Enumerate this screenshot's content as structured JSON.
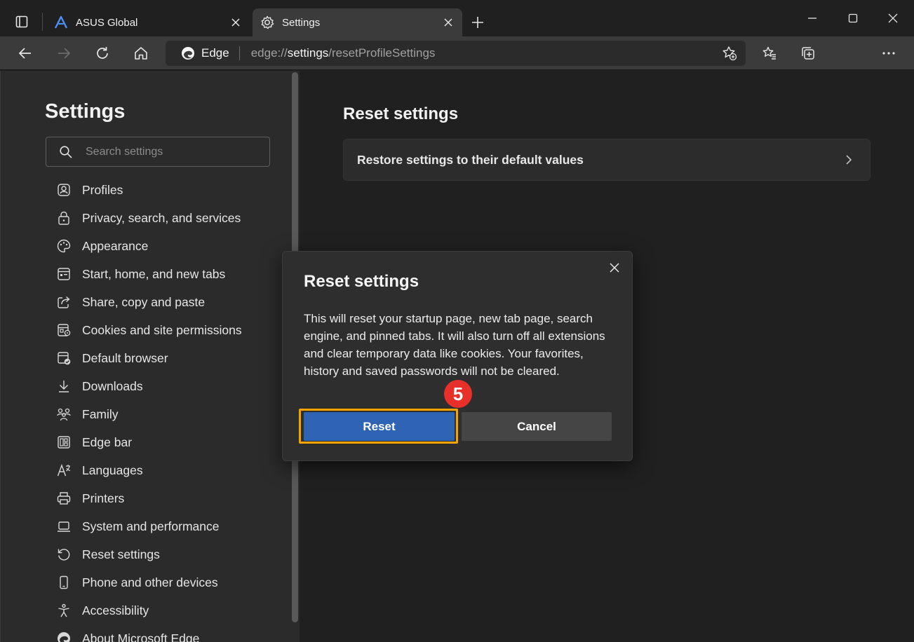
{
  "tabs": [
    {
      "title": "ASUS Global",
      "icon": "asus-logo-icon",
      "active": false
    },
    {
      "title": "Settings",
      "icon": "gear-icon",
      "active": true
    }
  ],
  "address_bar": {
    "site_name": "Edge",
    "url_scheme": "edge://",
    "url_host": "settings",
    "url_path": "/resetProfileSettings"
  },
  "sidebar": {
    "title": "Settings",
    "search_placeholder": "Search settings",
    "items": [
      {
        "label": "Profiles",
        "icon": "profile-icon"
      },
      {
        "label": "Privacy, search, and services",
        "icon": "lock-icon"
      },
      {
        "label": "Appearance",
        "icon": "palette-icon"
      },
      {
        "label": "Start, home, and new tabs",
        "icon": "start-page-icon"
      },
      {
        "label": "Share, copy and paste",
        "icon": "share-icon"
      },
      {
        "label": "Cookies and site permissions",
        "icon": "cookies-icon"
      },
      {
        "label": "Default browser",
        "icon": "default-browser-icon"
      },
      {
        "label": "Downloads",
        "icon": "download-icon"
      },
      {
        "label": "Family",
        "icon": "family-icon"
      },
      {
        "label": "Edge bar",
        "icon": "edge-bar-icon"
      },
      {
        "label": "Languages",
        "icon": "languages-icon"
      },
      {
        "label": "Printers",
        "icon": "printer-icon"
      },
      {
        "label": "System and performance",
        "icon": "laptop-icon"
      },
      {
        "label": "Reset settings",
        "icon": "reset-icon"
      },
      {
        "label": "Phone and other devices",
        "icon": "phone-icon"
      },
      {
        "label": "Accessibility",
        "icon": "accessibility-icon"
      },
      {
        "label": "About Microsoft Edge",
        "icon": "edge-logo-icon"
      }
    ]
  },
  "main": {
    "heading": "Reset settings",
    "card_label": "Restore settings to their default values"
  },
  "dialog": {
    "title": "Reset settings",
    "body": "This will reset your startup page, new tab page, search engine, and pinned tabs. It will also turn off all extensions and clear temporary data like cookies. Your favorites, history and saved passwords will not be cleared.",
    "reset_label": "Reset",
    "cancel_label": "Cancel"
  },
  "annotation": {
    "step_number": "5",
    "highlight_color": "#f5a400",
    "badge_color": "#e8302a"
  },
  "colors": {
    "primary_button": "#2f64b4",
    "secondary_button": "#454545"
  }
}
